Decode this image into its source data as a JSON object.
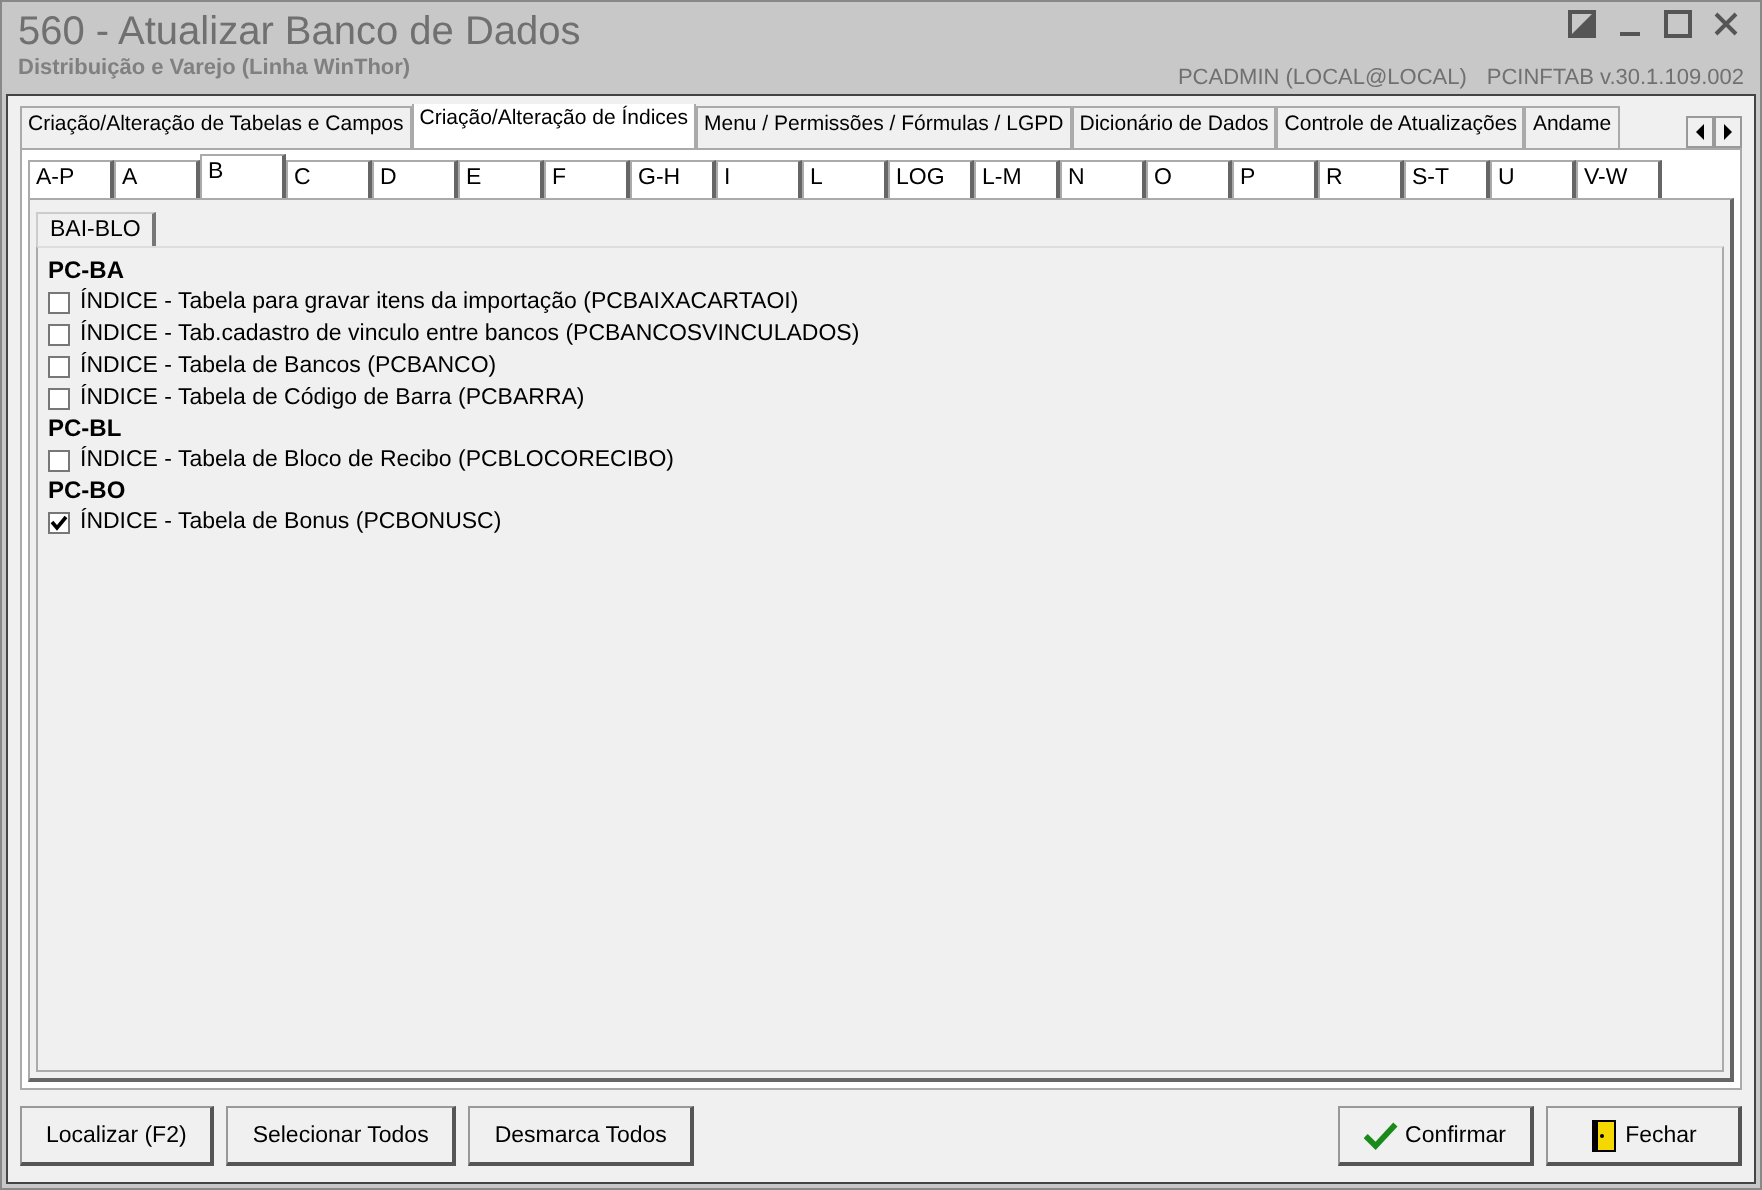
{
  "window": {
    "title": "560 - Atualizar Banco de Dados",
    "subtitle": "Distribuição e Varejo (Linha WinThor)",
    "user": "PCADMIN (LOCAL@LOCAL)",
    "version": "PCINFTAB  v.30.1.109.002"
  },
  "main_tabs": [
    {
      "label": "Criação/Alteração de Tabelas e Campos",
      "selected": false
    },
    {
      "label": "Criação/Alteração de Índices",
      "selected": true
    },
    {
      "label": "Menu / Permissões / Fórmulas / LGPD",
      "selected": false
    },
    {
      "label": "Dicionário de Dados",
      "selected": false
    },
    {
      "label": "Controle de Atualizações",
      "selected": false
    },
    {
      "label": "Andame",
      "selected": false
    }
  ],
  "letter_tabs": [
    {
      "label": "A-P",
      "selected": false
    },
    {
      "label": "A",
      "selected": false
    },
    {
      "label": "B",
      "selected": true
    },
    {
      "label": "C",
      "selected": false
    },
    {
      "label": "D",
      "selected": false
    },
    {
      "label": "E",
      "selected": false
    },
    {
      "label": "F",
      "selected": false
    },
    {
      "label": "G-H",
      "selected": false
    },
    {
      "label": "I",
      "selected": false
    },
    {
      "label": "L",
      "selected": false
    },
    {
      "label": "LOG",
      "selected": false
    },
    {
      "label": "L-M",
      "selected": false
    },
    {
      "label": "N",
      "selected": false
    },
    {
      "label": "O",
      "selected": false
    },
    {
      "label": "P",
      "selected": false
    },
    {
      "label": "R",
      "selected": false
    },
    {
      "label": "S-T",
      "selected": false
    },
    {
      "label": "U",
      "selected": false
    },
    {
      "label": "V-W",
      "selected": false
    }
  ],
  "sub_tabs": [
    {
      "label": "BAI-BLO",
      "selected": true
    }
  ],
  "groups": [
    {
      "title": "PC-BA",
      "items": [
        {
          "label": "ÍNDICE - Tabela para gravar itens da importação (PCBAIXACARTAOI)",
          "checked": false
        },
        {
          "label": "ÍNDICE - Tab.cadastro de vinculo entre bancos (PCBANCOSVINCULADOS)",
          "checked": false
        },
        {
          "label": "ÍNDICE - Tabela de Bancos (PCBANCO)",
          "checked": false
        },
        {
          "label": "ÍNDICE - Tabela de Código de Barra (PCBARRA)",
          "checked": false
        }
      ]
    },
    {
      "title": "PC-BL",
      "items": [
        {
          "label": "ÍNDICE - Tabela de Bloco de Recibo (PCBLOCORECIBO)",
          "checked": false
        }
      ]
    },
    {
      "title": "PC-BO",
      "items": [
        {
          "label": "ÍNDICE - Tabela de Bonus (PCBONUSC)",
          "checked": true
        }
      ]
    }
  ],
  "buttons_left": [
    "Localizar (F2)",
    "Selecionar Todos",
    "Desmarca Todos"
  ],
  "buttons_right": [
    {
      "label": "Confirmar",
      "kind": "confirm"
    },
    {
      "label": "Fechar",
      "kind": "close"
    }
  ]
}
